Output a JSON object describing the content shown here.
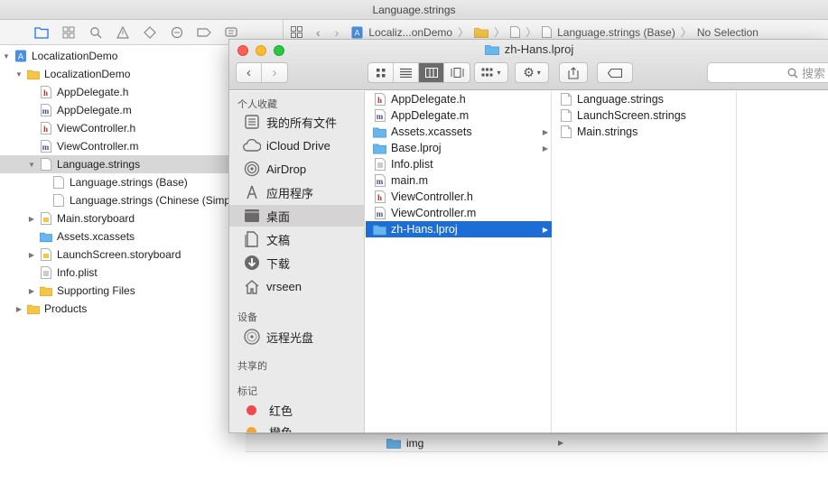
{
  "xcode": {
    "window_title": "Language.strings",
    "jump_bar": {
      "project": "Localiz...onDemo",
      "file": "Language.strings (Base)",
      "selection": "No Selection"
    },
    "navigator": [
      {
        "label": "LocalizationDemo",
        "indent": 0,
        "disclosure": "open",
        "icon": "project-icon",
        "selected": false
      },
      {
        "label": "LocalizationDemo",
        "indent": 1,
        "disclosure": "open",
        "icon": "folder-icon",
        "selected": false
      },
      {
        "label": "AppDelegate.h",
        "indent": 2,
        "disclosure": "none",
        "icon": "header-file-icon",
        "selected": false
      },
      {
        "label": "AppDelegate.m",
        "indent": 2,
        "disclosure": "none",
        "icon": "source-file-icon",
        "selected": false
      },
      {
        "label": "ViewController.h",
        "indent": 2,
        "disclosure": "none",
        "icon": "header-file-icon",
        "selected": false
      },
      {
        "label": "ViewController.m",
        "indent": 2,
        "disclosure": "none",
        "icon": "source-file-icon",
        "selected": false
      },
      {
        "label": "Language.strings",
        "indent": 2,
        "disclosure": "open",
        "icon": "strings-file-icon",
        "selected": true
      },
      {
        "label": "Language.strings (Base)",
        "indent": 3,
        "disclosure": "none",
        "icon": "strings-file-icon",
        "selected": false
      },
      {
        "label": "Language.strings (Chinese (Simplifi",
        "indent": 3,
        "disclosure": "none",
        "icon": "strings-file-icon",
        "selected": false
      },
      {
        "label": "Main.storyboard",
        "indent": 2,
        "disclosure": "closed",
        "icon": "storyboard-icon",
        "selected": false
      },
      {
        "label": "Assets.xcassets",
        "indent": 2,
        "disclosure": "none",
        "icon": "assets-folder-icon",
        "selected": false
      },
      {
        "label": "LaunchScreen.storyboard",
        "indent": 2,
        "disclosure": "closed",
        "icon": "storyboard-icon",
        "selected": false
      },
      {
        "label": "Info.plist",
        "indent": 2,
        "disclosure": "none",
        "icon": "plist-file-icon",
        "selected": false
      },
      {
        "label": "Supporting Files",
        "indent": 2,
        "disclosure": "closed",
        "icon": "folder-icon",
        "selected": false
      },
      {
        "label": "Products",
        "indent": 1,
        "disclosure": "closed",
        "icon": "folder-icon",
        "selected": false
      }
    ],
    "bottom_item": "img"
  },
  "finder": {
    "title": "zh-Hans.lproj",
    "search_placeholder": "搜索",
    "sidebar": {
      "favorites_header": "个人收藏",
      "favorites": [
        {
          "label": "我的所有文件",
          "icon": "all-files-icon",
          "selected": false
        },
        {
          "label": "iCloud Drive",
          "icon": "cloud-icon",
          "selected": false
        },
        {
          "label": "AirDrop",
          "icon": "airdrop-icon",
          "selected": false
        },
        {
          "label": "应用程序",
          "icon": "applications-icon",
          "selected": false
        },
        {
          "label": "桌面",
          "icon": "desktop-icon",
          "selected": true
        },
        {
          "label": "文稿",
          "icon": "documents-icon",
          "selected": false
        },
        {
          "label": "下载",
          "icon": "downloads-icon",
          "selected": false
        },
        {
          "label": "vrseen",
          "icon": "home-icon",
          "selected": false
        }
      ],
      "devices_header": "设备",
      "devices": [
        {
          "label": "远程光盘",
          "icon": "disc-icon",
          "selected": false
        }
      ],
      "shared_header": "共享的",
      "tags_header": "标记",
      "tags": [
        {
          "label": "红色",
          "color": "#f04b4b"
        },
        {
          "label": "橙色",
          "color": "#f5a331"
        }
      ]
    },
    "column1": [
      {
        "label": "AppDelegate.h",
        "icon": "header-file-icon",
        "has_children": false,
        "selected": false
      },
      {
        "label": "AppDelegate.m",
        "icon": "source-file-icon",
        "has_children": false,
        "selected": false
      },
      {
        "label": "Assets.xcassets",
        "icon": "folder-icon",
        "has_children": true,
        "selected": false
      },
      {
        "label": "Base.lproj",
        "icon": "folder-icon",
        "has_children": true,
        "selected": false
      },
      {
        "label": "Info.plist",
        "icon": "plist-file-icon",
        "has_children": false,
        "selected": false
      },
      {
        "label": "main.m",
        "icon": "source-file-icon",
        "has_children": false,
        "selected": false
      },
      {
        "label": "ViewController.h",
        "icon": "header-file-icon",
        "has_children": false,
        "selected": false
      },
      {
        "label": "ViewController.m",
        "icon": "source-file-icon",
        "has_children": false,
        "selected": false
      },
      {
        "label": "zh-Hans.lproj",
        "icon": "folder-icon",
        "has_children": true,
        "selected": true
      }
    ],
    "column2": [
      {
        "label": "Language.strings",
        "icon": "document-icon"
      },
      {
        "label": "LaunchScreen.strings",
        "icon": "document-icon"
      },
      {
        "label": "Main.strings",
        "icon": "document-icon"
      }
    ]
  },
  "colors": {
    "selection_blue": "#1c6dd6",
    "folder_blue": "#68b6ee",
    "folder_yellow": "#f5c645"
  }
}
